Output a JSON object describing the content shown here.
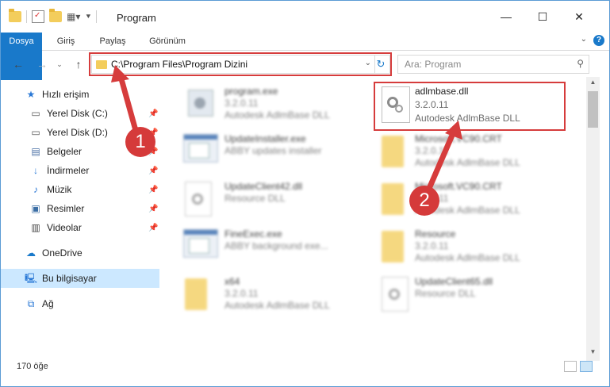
{
  "window": {
    "title": "Program",
    "controls": {
      "minimize": "—",
      "maximize": "☐",
      "close": "✕"
    }
  },
  "ribbon": {
    "tabs": [
      "Dosya",
      "Giriş",
      "Paylaş",
      "Görünüm"
    ],
    "help": "?"
  },
  "nav": {
    "address": "C:\\Program Files\\Program Dizini",
    "search_placeholder": "Ara: Program"
  },
  "sidebar": {
    "items": [
      {
        "label": "Hızlı erişim",
        "icon": "star-icon",
        "pinned": false
      },
      {
        "label": "Yerel Disk (C:)",
        "icon": "drive-icon",
        "pinned": true
      },
      {
        "label": "Yerel Disk (D:)",
        "icon": "drive-icon",
        "pinned": true
      },
      {
        "label": "Belgeler",
        "icon": "document-icon",
        "pinned": true
      },
      {
        "label": "İndirmeler",
        "icon": "download-icon",
        "pinned": true
      },
      {
        "label": "Müzik",
        "icon": "music-icon",
        "pinned": true
      },
      {
        "label": "Resimler",
        "icon": "image-icon",
        "pinned": true
      },
      {
        "label": "Videolar",
        "icon": "video-icon",
        "pinned": true
      },
      {
        "label": "OneDrive",
        "icon": "cloud-icon",
        "pinned": false
      },
      {
        "label": "Bu bilgisayar",
        "icon": "computer-icon",
        "pinned": false
      },
      {
        "label": "Ağ",
        "icon": "network-icon",
        "pinned": false
      }
    ]
  },
  "files": [
    {
      "name": "program.exe",
      "line1": "3.2.0.11",
      "line2": "Autodesk AdlmBase DLL",
      "icon": "gear-exe-icon"
    },
    {
      "name": "adlmbase.dll",
      "line1": "3.2.0.11",
      "line2": "Autodesk AdlmBase DLL",
      "icon": "dll-file-icon"
    },
    {
      "name": "UpdateInstaller.exe",
      "line1": "ABBY updates installer",
      "line2": "",
      "icon": "app-window-icon"
    },
    {
      "name": "Microsoft.VC90.CRT",
      "line1": "3.2.0.11",
      "line2": "Autodesk AdlmBase DLL",
      "icon": "folder-icon"
    },
    {
      "name": "UpdateClient42.dll",
      "line1": "Resource DLL",
      "line2": "",
      "icon": "dll-file-icon"
    },
    {
      "name": "Microsoft.VC90.CRT",
      "line1": "3.2.0.11",
      "line2": "Autodesk AdlmBase DLL",
      "icon": "folder-icon"
    },
    {
      "name": "FineExec.exe",
      "line1": "ABBY background exe...",
      "line2": "",
      "icon": "app-window-icon"
    },
    {
      "name": "Resource",
      "line1": "3.2.0.11",
      "line2": "Autodesk AdlmBase DLL",
      "icon": "folder-icon"
    },
    {
      "name": "x64",
      "line1": "3.2.0.11",
      "line2": "Autodesk AdlmBase DLL",
      "icon": "folder-icon"
    },
    {
      "name": "UpdateClient65.dll",
      "line1": "Resource DLL",
      "line2": "",
      "icon": "dll-file-icon"
    }
  ],
  "status": {
    "count": "170 öğe"
  },
  "callouts": [
    "1",
    "2"
  ],
  "colors": {
    "accent": "#1979ca",
    "highlight": "#d63c3c",
    "selection": "#cce8ff"
  }
}
